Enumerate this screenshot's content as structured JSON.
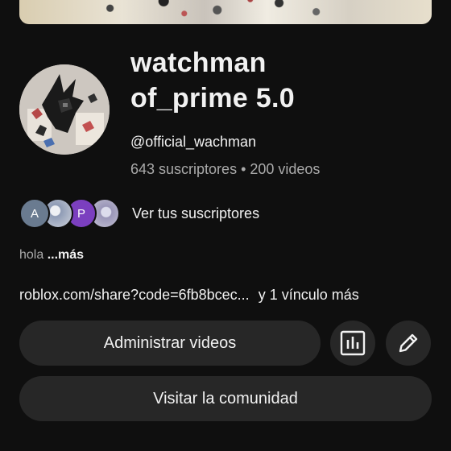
{
  "channel": {
    "name": "watchman of_prime 5.0",
    "handle": "@official_wachman",
    "stats": "643 suscriptores • 200 videos"
  },
  "subscribers": {
    "preview": [
      {
        "initial": "A",
        "color": "#6a7b90"
      },
      {
        "initial": "",
        "icon": "profile-photo"
      },
      {
        "initial": "P",
        "color": "#7b3fbf"
      },
      {
        "initial": "",
        "icon": "profile-photo"
      }
    ],
    "label": "Ver tus suscriptores"
  },
  "description": {
    "text": "hola",
    "more": "...más"
  },
  "links": {
    "first": "roblox.com/share?code=6fb8bcec...",
    "extra": "y 1 vínculo más"
  },
  "buttons": {
    "manage": "Administrar videos",
    "analytics_icon": "bar-chart-icon",
    "edit_icon": "pencil-icon",
    "community": "Visitar la comunidad"
  },
  "colors": {
    "background": "#0f0f0f",
    "button": "#272727",
    "secondary_text": "#aaaaaa"
  }
}
